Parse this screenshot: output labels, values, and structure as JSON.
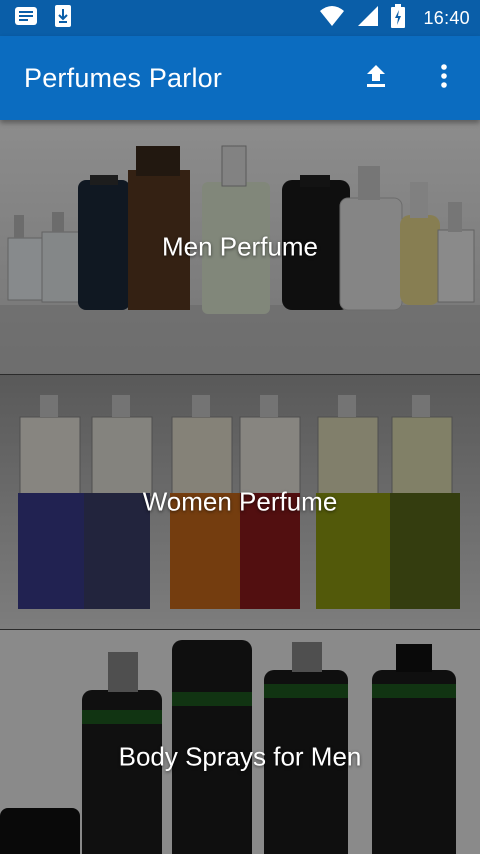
{
  "status_bar": {
    "time": "16:40",
    "icons": [
      "notification-news-icon",
      "download-notification-icon",
      "wifi-icon",
      "cell-signal-icon",
      "battery-charging-icon"
    ]
  },
  "app_bar": {
    "title": "Perfumes Parlor",
    "actions": [
      "upload-icon",
      "overflow-menu-icon"
    ],
    "color": "#0b6cc0"
  },
  "categories": [
    {
      "label": "Men Perfume"
    },
    {
      "label": "Women Perfume"
    },
    {
      "label": "Body Sprays for Men"
    }
  ]
}
